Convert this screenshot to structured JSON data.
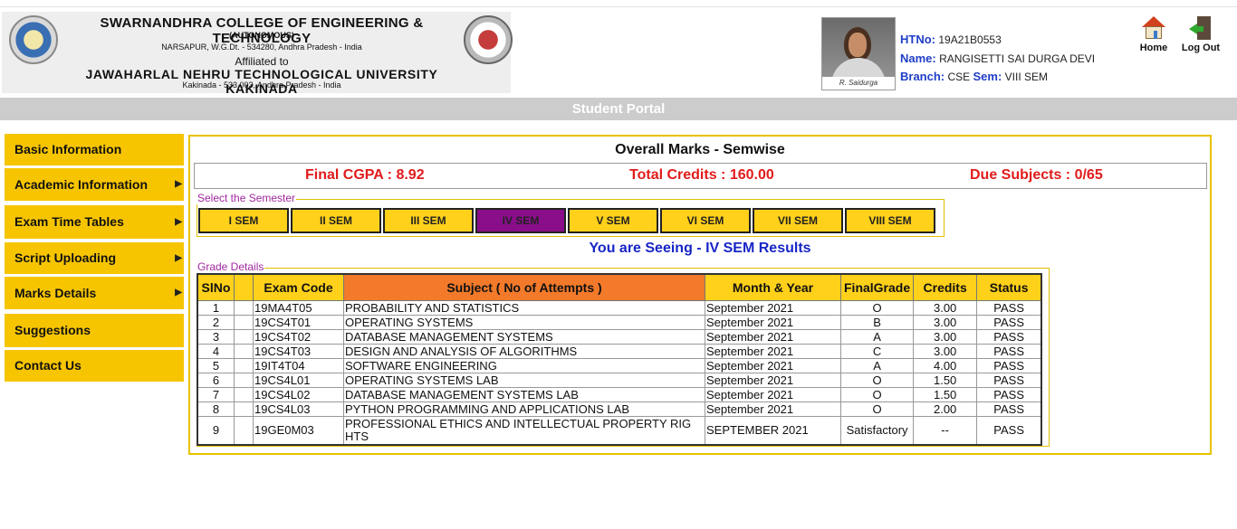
{
  "header": {
    "college_name": "SWARNANDHRA COLLEGE OF ENGINEERING & TECHNOLOGY",
    "autonomous": "(AUTONOMOUS)",
    "address": "NARSAPUR, W.G.Dt. - 534280, Andhra Pradesh - India",
    "affiliated_to": "Affiliated to",
    "university": "JAWAHARLAL NEHRU TECHNOLOGICAL UNIVERSITY KAKINADA",
    "university_address": "Kakinada - 533 003, Andhra Pradesh - India"
  },
  "student": {
    "htno_label": "HTNo:",
    "htno": "19A21B0553",
    "name_label": "Name:",
    "name": "RANGISETTI SAI DURGA DEVI",
    "branch_label": "Branch:",
    "branch": "CSE",
    "sem_label": "Sem:",
    "sem": "VIII SEM",
    "signature": "R. Saidurga"
  },
  "nav": {
    "home": "Home",
    "logout": "Log Out"
  },
  "portal_title": "Student Portal",
  "sidebar": {
    "items": [
      {
        "label": "Basic Information",
        "has_arrow": false
      },
      {
        "label": "Academic Information",
        "has_arrow": true
      },
      {
        "label": "Exam Time Tables",
        "has_arrow": true
      },
      {
        "label": "Script Uploading",
        "has_arrow": true
      },
      {
        "label": "Marks Details",
        "has_arrow": true
      },
      {
        "label": "Suggestions",
        "has_arrow": false
      },
      {
        "label": "Contact Us",
        "has_arrow": false
      }
    ],
    "arrow_glyph": "▶"
  },
  "main": {
    "title": "Overall Marks - Semwise",
    "cgpa": "Final CGPA : 8.92",
    "credits": "Total Credits : 160.00",
    "due": "Due Subjects : 0/65",
    "semester_legend": "Select the Semester",
    "semesters": [
      "I SEM",
      "II SEM",
      "III SEM",
      "IV SEM",
      "V SEM",
      "VI SEM",
      "VII SEM",
      "VIII SEM"
    ],
    "active_semester": "IV SEM",
    "seeing": "You are Seeing - IV SEM Results",
    "grade_legend": "Grade Details",
    "columns": [
      "SlNo",
      "",
      "Exam Code",
      "Subject ( No of Attempts )",
      "Month & Year",
      "FinalGrade",
      "Credits",
      "Status"
    ],
    "rows": [
      [
        "1",
        "",
        "19MA4T05",
        "PROBABILITY AND STATISTICS",
        "September 2021",
        "O",
        "3.00",
        "PASS"
      ],
      [
        "2",
        "",
        "19CS4T01",
        "OPERATING SYSTEMS",
        "September 2021",
        "B",
        "3.00",
        "PASS"
      ],
      [
        "3",
        "",
        "19CS4T02",
        "DATABASE MANAGEMENT SYSTEMS",
        "September 2021",
        "A",
        "3.00",
        "PASS"
      ],
      [
        "4",
        "",
        "19CS4T03",
        "DESIGN AND ANALYSIS OF ALGORITHMS",
        "September 2021",
        "C",
        "3.00",
        "PASS"
      ],
      [
        "5",
        "",
        "19IT4T04",
        "SOFTWARE ENGINEERING",
        "September 2021",
        "A",
        "4.00",
        "PASS"
      ],
      [
        "6",
        "",
        "19CS4L01",
        "OPERATING SYSTEMS LAB",
        "September 2021",
        "O",
        "1.50",
        "PASS"
      ],
      [
        "7",
        "",
        "19CS4L02",
        "DATABASE MANAGEMENT SYSTEMS LAB",
        "September 2021",
        "O",
        "1.50",
        "PASS"
      ],
      [
        "8",
        "",
        "19CS4L03",
        "PYTHON PROGRAMMING AND APPLICATIONS LAB",
        "September 2021",
        "O",
        "2.00",
        "PASS"
      ],
      [
        "9",
        "",
        "19GE0M03",
        "PROFESSIONAL ETHICS AND INTELLECTUAL PROPERTY RIG HTS",
        "SEPTEMBER 2021",
        "Satisfactory",
        "--",
        "PASS"
      ]
    ]
  },
  "colors": {
    "menu": "#f7c500",
    "sem_button": "#ffd11a",
    "active_sem": "#8a0e8a",
    "subject_header": "#f27a2a",
    "summary_text": "#e11b1b",
    "seeing_text": "#1826c7",
    "label_blue": "#1f3ec7"
  },
  "icons": {
    "home": "home-icon",
    "logout": "logout-icon"
  }
}
